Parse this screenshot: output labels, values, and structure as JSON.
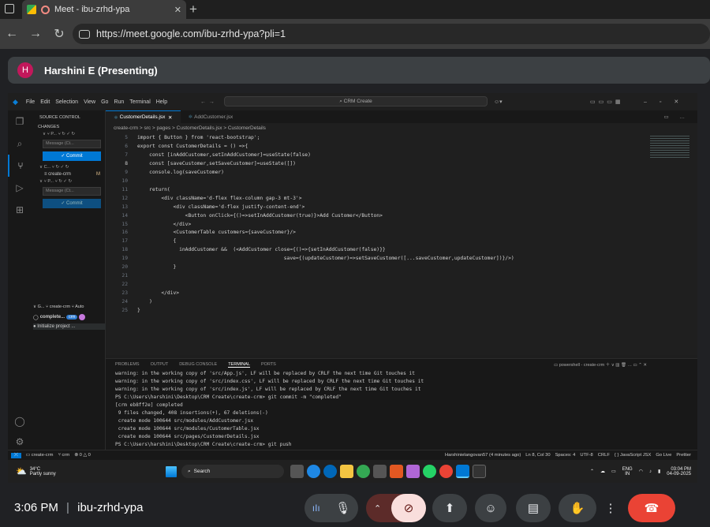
{
  "browser": {
    "tab_title": "Meet - ibu-zrhd-ypa",
    "new_tab": "+",
    "close": "✕",
    "url": "https://meet.google.com/ibu-zrhd-ypa?pli=1"
  },
  "meet": {
    "presenter_initial": "H",
    "presenter_name": "Harshini E (Presenting)",
    "time": "3:06 PM",
    "separator": "|",
    "meeting_code": "ibu-zrhd-ypa"
  },
  "vscode": {
    "menu": [
      "File",
      "Edit",
      "Selection",
      "View",
      "Go",
      "Run",
      "Terminal",
      "Help"
    ],
    "search": "CRM Create",
    "sidebar": {
      "title": "SOURCE CONTROL",
      "changes": "CHANGES",
      "message_placeholder": "Message (Ct...",
      "commit": "Commit",
      "repo_short": "C...",
      "file": "create-crm",
      "file_badge": "M",
      "graph": "G...",
      "graph_branch": "create-crm",
      "graph_auto": "Auto",
      "commit1": "complete...",
      "commit1_badge": "crm",
      "commit2": "Initialize project ..."
    },
    "tabs": [
      "CustomerDetails.jsx",
      "AddCustomer.jsx"
    ],
    "breadcrumb": "create-crm > src > pages > CustomerDetails.jsx > CustomerDetails",
    "code_lines": [
      {
        "n": "5",
        "t": "import { Button } from 'react-bootstrap';"
      },
      {
        "n": "6",
        "t": "export const CustomerDetails = () =>{"
      },
      {
        "n": "7",
        "t": "    const [inAddCustomer,setInAddCustomer]=useState(false)"
      },
      {
        "n": "8",
        "t": "    const [saveCustomer,setSaveCustomer]=useState([])"
      },
      {
        "n": "9",
        "t": "    console.log(saveCustomer)"
      },
      {
        "n": "10",
        "t": ""
      },
      {
        "n": "11",
        "t": "    return("
      },
      {
        "n": "12",
        "t": "        <div className='d-flex flex-column gap-3 mt-3'>"
      },
      {
        "n": "13",
        "t": "            <div className='d-flex justify-content-end'>"
      },
      {
        "n": "14",
        "t": "                <Button onClick={()=>setInAddCustomer(true)}>Add Customer</Button>"
      },
      {
        "n": "15",
        "t": "            </div>"
      },
      {
        "n": "16",
        "t": "            <CustomerTable customers={saveCustomer}/>"
      },
      {
        "n": "17",
        "t": "            {"
      },
      {
        "n": "18",
        "t": "              inAddCustomer &&  (<AddCustomer close={()=>{setInAddCustomer(false)}}"
      },
      {
        "n": "19",
        "t": "                                                 save={(updateCustomer)=>setSaveCustomer([...saveCustomer,updateCustomer])}/>)"
      },
      {
        "n": "20",
        "t": "            }"
      },
      {
        "n": "21",
        "t": ""
      },
      {
        "n": "22",
        "t": ""
      },
      {
        "n": "23",
        "t": "        </div>"
      },
      {
        "n": "24",
        "t": "    )"
      },
      {
        "n": "25",
        "t": "}"
      }
    ],
    "panel_tabs": [
      "PROBLEMS",
      "OUTPUT",
      "DEBUG CONSOLE",
      "TERMINAL",
      "PORTS"
    ],
    "terminal_name": "powershell - create-crm",
    "terminal_lines": [
      "warning: in the working copy of 'src/App.js', LF will be replaced by CRLF the next time Git touches it",
      "warning: in the working copy of 'src/index.css', LF will be replaced by CRLF the next time Git touches it",
      "warning: in the working copy of 'src/index.js', LF will be replaced by CRLF the next time Git touches it",
      "PS C:\\Users\\harshini\\Desktop\\CRM Create\\create-crm> git commit -m \"completed\"",
      "[crm eb8ff2e] completed",
      " 9 files changed, 408 insertions(+), 67 deletions(-)",
      " create mode 100644 src/modules/AddCustomer.jsx",
      " create mode 100644 src/modules/CustomerTable.jsx",
      " create mode 100644 src/pages/CustomerDetails.jsx",
      "PS C:\\Users\\harshini\\Desktop\\CRM Create\\create-crm> git push"
    ],
    "status": {
      "branch": "create-crm",
      "git": "crm",
      "problems": "0 △ 0",
      "blame": "Harshinielangovan57 (4 minutes ago)",
      "position": "Ln 8, Col 30",
      "spaces": "Spaces: 4",
      "encoding": "UTF-8",
      "eol": "CRLF",
      "lang": "{ } JavaScript JSX",
      "golive": "Go Live",
      "prettier": "Prettier"
    }
  },
  "taskbar": {
    "temp": "34°C",
    "weather": "Partly sunny",
    "search": "Search",
    "lang": "ENG",
    "region": "IN",
    "clock": "03:04 PM",
    "date": "04-09-2025"
  },
  "colors": {
    "end_call": "#ea4335",
    "camera_off": "#f9dedc",
    "vscode_blue": "#0078d4"
  }
}
